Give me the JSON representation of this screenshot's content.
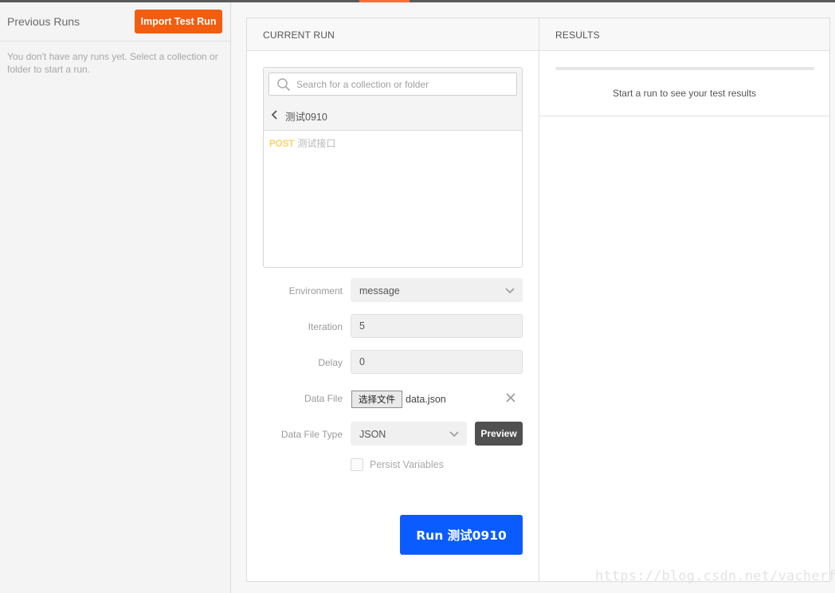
{
  "sidebar": {
    "title": "Previous Runs",
    "import_button": "Import Test Run",
    "empty_message": "You don't have any runs yet. Select a collection or folder to start a run."
  },
  "current_run": {
    "header": "CURRENT RUN",
    "search_placeholder": "Search for a collection or folder",
    "breadcrumb_label": "测试0910",
    "requests": [
      {
        "method": "POST",
        "name": "测试接口"
      }
    ],
    "form": {
      "environment_label": "Environment",
      "environment_value": "message",
      "iteration_label": "Iteration",
      "iteration_value": "5",
      "delay_label": "Delay",
      "delay_value": "0",
      "data_file_label": "Data File",
      "choose_file_button": "选择文件",
      "file_name": "data.json",
      "data_file_type_label": "Data File Type",
      "data_file_type_value": "JSON",
      "preview_button": "Preview",
      "persist_variables_label": "Persist Variables",
      "persist_variables_checked": false
    },
    "run_button": "Run 测试0910"
  },
  "results": {
    "header": "RESULTS",
    "empty_message": "Start a run to see your test results"
  },
  "watermark": "https://blog.csdn.net/vacherf",
  "colors": {
    "accent_orange": "#f25d10",
    "run_blue": "#0a5cff",
    "post_method": "#fcd36a"
  }
}
